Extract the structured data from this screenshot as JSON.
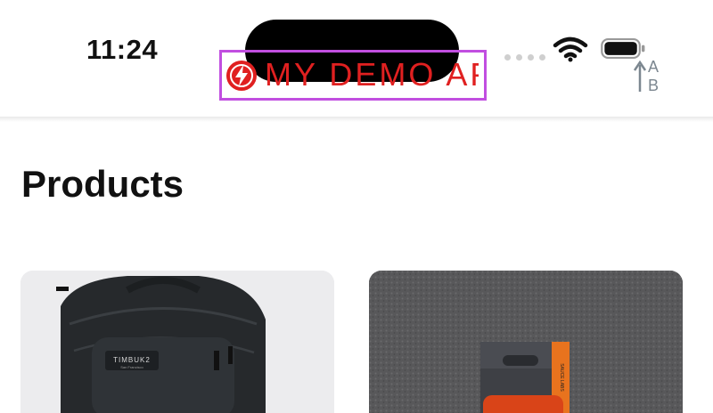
{
  "status_bar": {
    "time": "11:24",
    "icons": [
      "cellular-dots-icon",
      "wifi-icon",
      "battery-icon",
      "sort-az-icon"
    ],
    "sort_letters": [
      "A",
      "B"
    ]
  },
  "header": {
    "logo_text": "MY DEMO APP",
    "logo_color": "#e02020",
    "highlight_color": "#c14ee0"
  },
  "main": {
    "title": "Products",
    "products": [
      {
        "image_label": "TIMBUK2",
        "image_subtitle": "San Francisco"
      },
      {
        "image_label": "SAUCE LABS"
      }
    ]
  }
}
